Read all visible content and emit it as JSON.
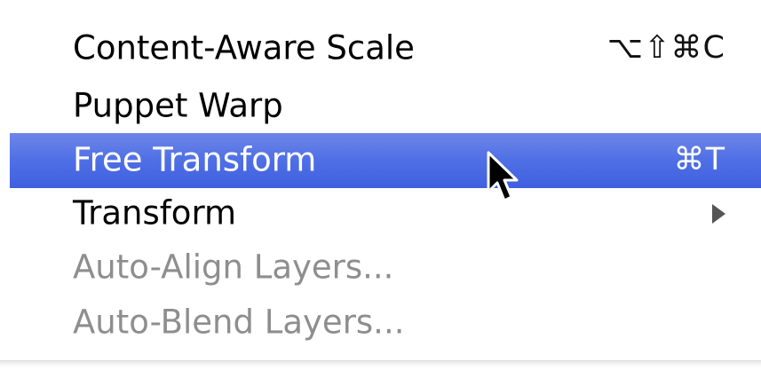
{
  "menu": {
    "items": [
      {
        "label": "Content-Aware Scale",
        "shortcut": "⌥⇧⌘C",
        "enabled": true
      },
      {
        "label": "Puppet Warp",
        "shortcut": "",
        "enabled": true
      },
      {
        "label": "Free Transform",
        "shortcut": "⌘T",
        "enabled": true,
        "highlighted": true
      },
      {
        "label": "Transform",
        "shortcut": "",
        "enabled": true,
        "submenu": true
      },
      {
        "label": "Auto-Align Layers...",
        "shortcut": "",
        "enabled": false
      },
      {
        "label": "Auto-Blend Layers...",
        "shortcut": "",
        "enabled": false
      }
    ]
  },
  "colors": {
    "highlight": "#5171e6",
    "disabled_text": "#8e8e8e"
  },
  "icons": {
    "cursor": "mouse-pointer-icon",
    "submenu": "submenu-arrow-icon"
  }
}
